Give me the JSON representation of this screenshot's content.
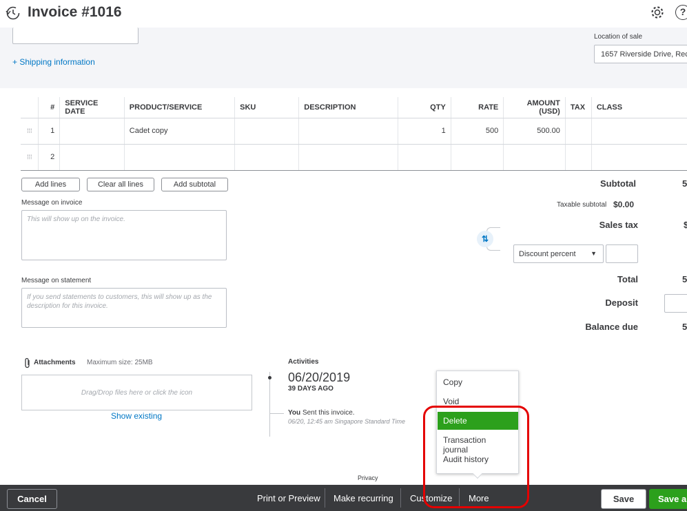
{
  "header": {
    "title": "Invoice #1016"
  },
  "top": {
    "shipping_link": "+ Shipping information",
    "location_label": "Location of sale",
    "location_value": "1657 Riverside Drive, Rec"
  },
  "table": {
    "headers": [
      "#",
      "SERVICE DATE",
      "PRODUCT/SERVICE",
      "SKU",
      "DESCRIPTION",
      "QTY",
      "RATE",
      "AMOUNT (USD)",
      "TAX",
      "CLASS"
    ],
    "rows": [
      {
        "num": "1",
        "service_date": "",
        "product": "Cadet copy",
        "sku": "",
        "description": "",
        "qty": "1",
        "rate": "500",
        "amount": "500.00",
        "tax": "",
        "class": ""
      },
      {
        "num": "2",
        "service_date": "",
        "product": "",
        "sku": "",
        "description": "",
        "qty": "",
        "rate": "",
        "amount": "",
        "tax": "",
        "class": ""
      }
    ]
  },
  "buttons": {
    "add_lines": "Add lines",
    "clear_all_lines": "Clear all lines",
    "add_subtotal": "Add subtotal"
  },
  "messages": {
    "invoice_label": "Message on invoice",
    "invoice_placeholder": "This will show up on the invoice.",
    "statement_label": "Message on statement",
    "statement_placeholder": "If you send statements to customers, this will show up as the description for this invoice."
  },
  "totals": {
    "subtotal_label": "Subtotal",
    "subtotal_value": "5",
    "taxable_label": "Taxable subtotal",
    "taxable_value": "$0.00",
    "sales_tax_label": "Sales tax",
    "sales_tax_value": "$",
    "discount_select": "Discount percent",
    "total_label": "Total",
    "total_value": "5",
    "deposit_label": "Deposit",
    "balance_label": "Balance due",
    "balance_value": "5"
  },
  "attachments": {
    "label": "Attachments",
    "max_size": "Maximum size: 25MB",
    "drop_text": "Drag/Drop files here or click the icon",
    "show_existing": "Show existing"
  },
  "activities": {
    "label": "Activities",
    "date": "06/20/2019",
    "ago": "39 DAYS AGO",
    "who": "You",
    "action": "Sent this invoice.",
    "detail": "06/20, 12:45 am Singapore Standard Time"
  },
  "menu": {
    "items": [
      "Copy",
      "Void",
      "Delete",
      "Transaction journal",
      "Audit history"
    ]
  },
  "footer": {
    "privacy": "Privacy",
    "cancel": "Cancel",
    "print_preview": "Print or Preview",
    "make_recurring": "Make recurring",
    "customize": "Customize",
    "more": "More",
    "save": "Save",
    "save_and": "Save an"
  },
  "colors": {
    "accent_green": "#2ca01c",
    "link_blue": "#0077c5",
    "footer_dark": "#393a3d",
    "highlight_red": "#e40000"
  }
}
